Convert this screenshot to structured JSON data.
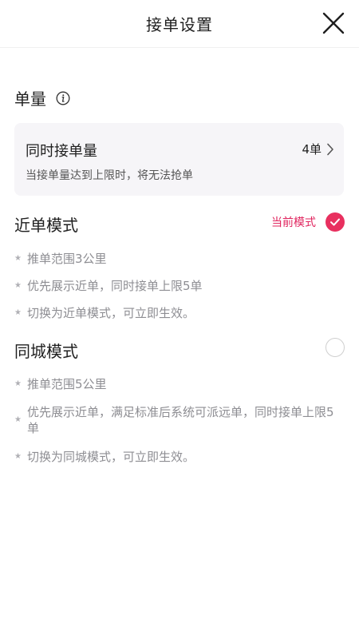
{
  "header": {
    "title": "接单设置"
  },
  "volume": {
    "title": "单量",
    "card": {
      "title": "同时接单量",
      "value": "4单",
      "subtitle": "当接单量达到上限时，将无法抢单"
    }
  },
  "near_mode": {
    "title": "近单模式",
    "status": "当前模式",
    "selected": true,
    "bullets": [
      "推单范围3公里",
      "优先展示近单，同时接单上限5单",
      "切换为近单模式，可立即生效。"
    ]
  },
  "city_mode": {
    "title": "同城模式",
    "selected": false,
    "bullets": [
      "推单范围5公里",
      "优先展示近单，满足标准后系统可派远单，同时接单上限5单",
      "切换为同城模式，可立即生效。"
    ]
  },
  "colors": {
    "accent": "#e8305f",
    "muted_text": "#8e8e93",
    "card_bg": "#f6f5f8"
  },
  "icons": {
    "close": "close-icon",
    "info": "info-icon",
    "chevron": "chevron-right-icon",
    "check": "check-icon",
    "star": "star-icon"
  }
}
